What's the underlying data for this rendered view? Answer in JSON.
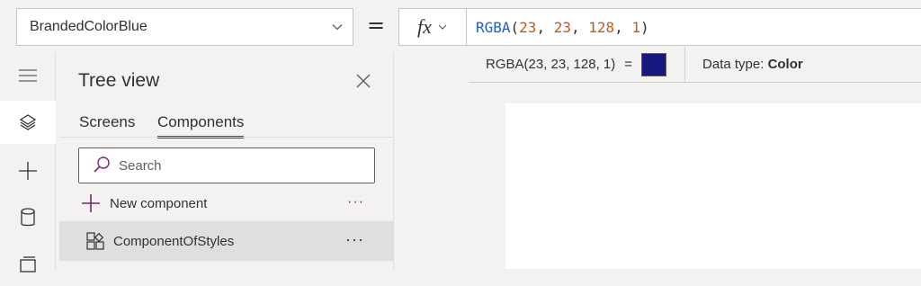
{
  "formula_bar": {
    "property": "BrandedColorBlue",
    "equals": "=",
    "fx_label": "fx",
    "formula_tokens": [
      {
        "t": "RGBA",
        "k": "fn"
      },
      {
        "t": "(",
        "k": "punc"
      },
      {
        "t": "23",
        "k": "num"
      },
      {
        "t": ", ",
        "k": "punc"
      },
      {
        "t": "23",
        "k": "num"
      },
      {
        "t": ", ",
        "k": "punc"
      },
      {
        "t": "128",
        "k": "num"
      },
      {
        "t": ", ",
        "k": "punc"
      },
      {
        "t": "1",
        "k": "num"
      },
      {
        "t": ")",
        "k": "punc"
      }
    ]
  },
  "result": {
    "expression": "RGBA(23, 23, 128, 1)",
    "equals": "=",
    "swatch_color": "#171780",
    "data_type_label": "Data type:",
    "data_type_value": "Color"
  },
  "left_rail": {
    "items": [
      {
        "icon": "hamburger-menu-icon"
      },
      {
        "icon": "layers-icon",
        "active": true
      },
      {
        "icon": "plus-icon"
      },
      {
        "icon": "database-icon"
      },
      {
        "icon": "media-icon"
      }
    ]
  },
  "tree": {
    "title": "Tree view",
    "tabs": [
      {
        "label": "Screens"
      },
      {
        "label": "Components",
        "active": true
      }
    ],
    "search_placeholder": "Search",
    "new_component_label": "New component",
    "new_component_more": "···",
    "components": [
      {
        "label": "ComponentOfStyles",
        "more": "···"
      }
    ]
  },
  "colors": {
    "accent": "#742774",
    "formula_function": "#1f5fbf",
    "formula_number": "#c05a17"
  }
}
